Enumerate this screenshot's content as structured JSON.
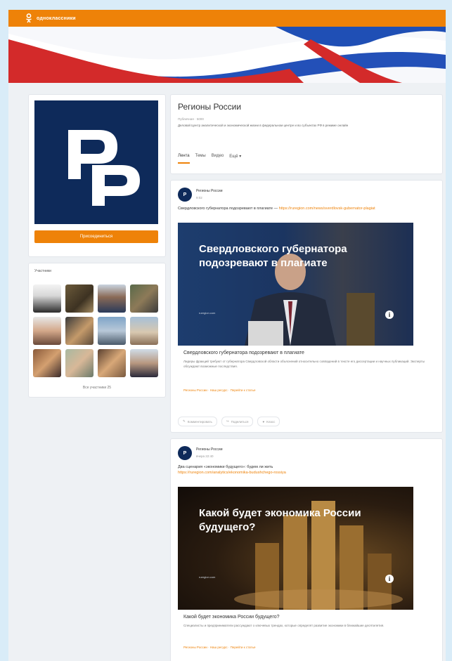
{
  "topbar": {
    "site_name": "одноклассники"
  },
  "colors": {
    "accent": "#ee8208",
    "brand_dark": "#0e2a5a"
  },
  "left": {
    "join_label": "Присоединиться",
    "members_title": "Участники",
    "show_all": "Все участники 25",
    "members_count": 12
  },
  "group": {
    "title": "Регионы России",
    "subtitle": "Публичная · 5000",
    "description": "Деловой Центр аналитической и экономической жизни в федеральном центре и во субъектах РФ в режиме онлайн",
    "tabs": [
      "Лента",
      "Темы",
      "Видео",
      "Ещё ▾"
    ]
  },
  "posts": [
    {
      "author": "Регионы России",
      "time": "9:02",
      "text": "Свердловского губернатора подозревают в плагиате —",
      "link": "https://ruregion.com/news/sverdlovsk-gubernator-plagiat",
      "image_headline": "Свердловского губернатора подозревают в плагиате",
      "image_source": "ruregion.com",
      "link_title": "Свердловского губернатора подозревают в плагиате",
      "link_desc": "Лидеры фракций требуют от губернатора Свердловской области объяснений относительно совпадений в тексте его диссертации и научных публикаций. Эксперты обсуждают возможные последствия.",
      "link_source": "Регионы России · Наш ресурс · Перейти к статье",
      "actions": [
        "Комментировать",
        "Поделиться",
        "Класс"
      ]
    },
    {
      "author": "Регионы России",
      "time": "вчера 22:40",
      "text": "Два сценария «экономики будущего»: будем ли жить",
      "link": "https://ruregion.com/analytics/ekonomika-budushchego-rossiya",
      "image_headline": "Какой будет экономика России будущего?",
      "image_source": "ruregion.com",
      "link_title": "Какой будет экономика России будущего?",
      "link_desc": "Специалисты и предприниматели рассуждают о ключевых трендах, которые определят развитие экономики в ближайшие десятилетия.",
      "link_source": "Регионы России · Наш ресурс · Перейти к статье"
    }
  ]
}
